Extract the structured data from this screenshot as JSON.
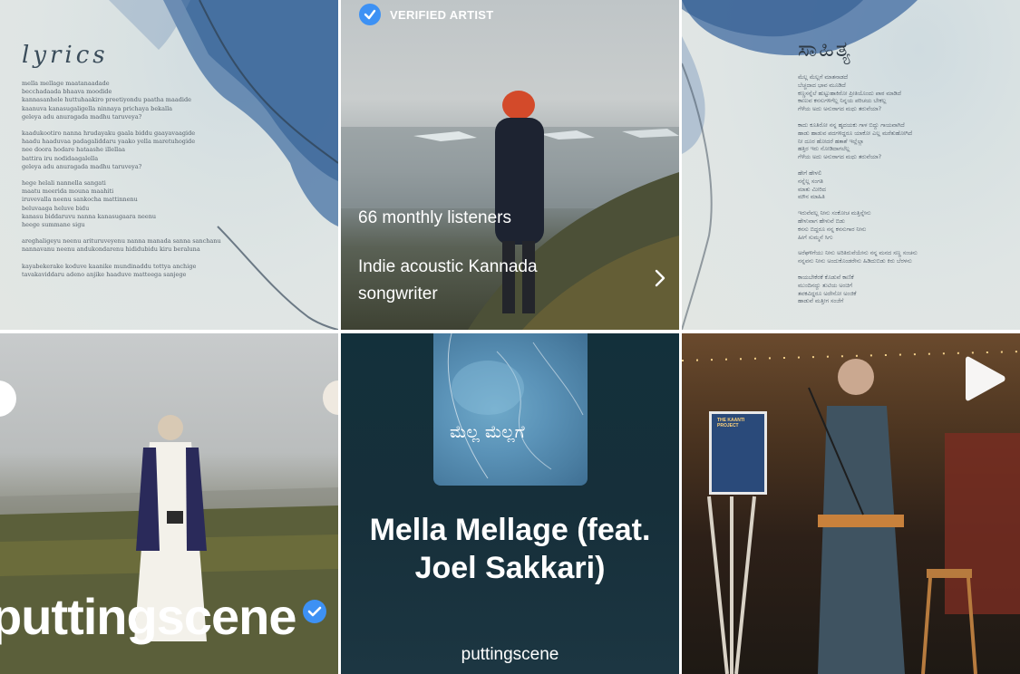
{
  "lyrics_card": {
    "title": "lyrics",
    "stanzas": [
      [
        "mella mellage maatanaadade",
        "becchadaada bhaava moodide",
        "kannasanhele huttuhaakiro preetiyondu paatha maadide",
        "kaanuva kanasugaligella ninnaya prichaya bekalla",
        "geleya adu anuragada madhu taruveya?"
      ],
      [
        "kaadukootiro nanna hrudayaku gaala biddu gaayavaagide",
        "haadu haaduvaa padagaliddaru yaako yella maretuhogide",
        "nee doora hodare hataashe illellaa",
        "battira iru nodidaagalella",
        "geleya adu anuragada madhu taruveya?"
      ],
      [
        "hege helali nannella sangati",
        "maatu meerida mouna maahiti",
        "iruvevalla neenu sankocha mattinnenu",
        "beluvaaga heluve bidu",
        "kanasu biddaruvu nanna kanasugaara neenu",
        "heege summane sigu"
      ],
      [
        "areghaligeyu neenu arituruveyenu nanna manada sanna sanchanu",
        "nannavanu neenu andukondarenu hididubidu kiru beraluna"
      ],
      [
        "kayabekerake koduve kaanike mundinaddu tottya anchige",
        "tavakaviddaru adeno anjike haaduve matteega sanjege"
      ]
    ]
  },
  "artist_card": {
    "verified_label": "VERIFIED ARTIST",
    "listeners": "66 monthly listeners",
    "bio": "Indie acoustic Kannada songwriter",
    "badge_color": "#3d91f4"
  },
  "kannada_card": {
    "title": "ಸಾಹಿತ್ಯ",
    "stanzas": [
      [
        "ಮೆಲ್ಲ ಮೆಲ್ಲಗೆ ಮಾತನಾಡದೆ",
        "ಬೆಚ್ಚದಾದ ಭಾವ ಮೂಡಿದೆ",
        "ಕಣ್ಣಸನ್ನೆಲೆ ಹುಟ್ಟುಹಾಕಿರೋ ಪ್ರೀತಿಯೊಂದು ಪಾಠ ಮಾಡಿದೆ",
        "ಕಾಣುವ ಕನಸುಗಳಿಗೆಲ್ಲ ನಿನ್ನಯ ಪರಿಚಯ ಬೇಕಲ್ಲ",
        "ಗೆಳೆಯ ಅದು ಅನುರಾಗದ ಮಧು ತರುವೆಯಾ?"
      ],
      [
        "ಕಾದು ಕೂತಿರೋ ನನ್ನ ಹೃದಯಕು ಗಾಳ ಬಿದ್ದು ಗಾಯವಾಗಿದೆ",
        "ಹಾಡು ಹಾಡುವ ಪದಗಳಿದ್ದರೂ ಯಾಕೋ ಎಲ್ಲ ಮರೆತುಹೋಗಿದೆ",
        "ನೀ ದೂರ ಹೋದರೆ ಹತಾಶೆ ಇಲ್ಲೆಲ್ಲಾ",
        "ಹತ್ತಿರ ಇರು ನೋಡಿದಾಗಲೆಲ್ಲ",
        "ಗೆಳೆಯ ಅದು ಅನುರಾಗದ ಮಧು ತರುವೆಯಾ?"
      ],
      [
        "ಹೇಗೆ ಹೇಳಲಿ",
        "ನನ್ನೆಲ್ಲ ಸಂಗತಿ",
        "ಮಾತು ಮೀರಿದ",
        "ಮೌನ ಮಾಹಿತಿ"
      ],
      [
        "ಇರುವೆವಲ್ಲ ನೀನು ಸಂಕೋಚ ಮತ್ತಿನ್ನೇನು",
        "ಹೇಳುವಾಗ ಹೇಳುವೆ ಬಿಡು",
        "ಕನಸು ಬಿದ್ದರೂ ನನ್ನ ಕನಸುಗಾರ ನೀನು",
        "ಹೀಗೆ ಸುಮ್ಮನೆ ಸಿಗು"
      ],
      [
        "ಅರೆಘಳಿಗೆಯು ನೀನು ಅರಿತಿರುವೆಯೇನು ನನ್ನ ಮನದ ಸಣ್ಣ ಸಂಚನು",
        "ನನ್ನವನು ನೀನು ಅಂದುಕೊಂಡರೇನು ಹಿಡಿದುಬಿಡು ಕಿರು ಬೆರಳನು"
      ],
      [
        "ಕಾಯಬೇಕೆರಕೆ ಕೊಡುವೆ ಕಾಣಿಕೆ",
        "ಮುಂದಿನದ್ದು ತುಟಿಯ ಅಂಚಿಗೆ",
        "ತವಕವಿದ್ದರೂ ಅದೇನೋ ಅಂಜಿಕೆ",
        "ಹಾಡುವೆ ಮತ್ತೀಗ ಸಂಜೆಗೆ"
      ]
    ]
  },
  "promo_card": {
    "brand_name": "puttingscene",
    "badge_color": "#3d91f4"
  },
  "track_card": {
    "album_script": "ಮೆಲ್ಲ ಮೆಲ್ಲಗೆ",
    "title": "Mella Mellage (feat. Joel Sakkari)",
    "artist": "puttingscene"
  },
  "live_card": {
    "poster_text": "THE KAANTI PROJECT"
  }
}
